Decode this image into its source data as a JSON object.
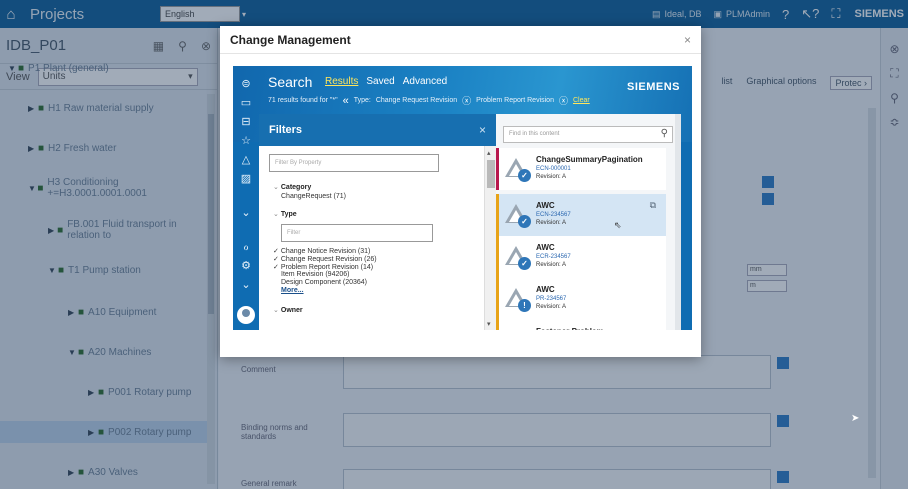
{
  "topbar": {
    "title": "Projects",
    "language": "English",
    "user_items": [
      "Ideal, DB",
      "PLMAdmin"
    ],
    "brand": "SIEMENS",
    "icons": [
      "home-icon",
      "help-icon",
      "context-help-icon",
      "expand-icon"
    ]
  },
  "sidebar": {
    "id": "IDB_P01",
    "view_label": "View",
    "view_value": "Units",
    "tree": [
      {
        "label": "P1 Plant (general)",
        "indent": 0,
        "expanded": true
      },
      {
        "label": "H1 Raw material supply",
        "indent": 1,
        "expanded": false
      },
      {
        "label": "H2 Fresh water",
        "indent": 1,
        "expanded": false
      },
      {
        "label": "H3 Conditioning +=H3.0001.0001.0001",
        "indent": 1,
        "expanded": true
      },
      {
        "label": "FB.001 Fluid transport in relation to",
        "indent": 2,
        "expanded": false
      },
      {
        "label": "T1 Pump station",
        "indent": 2,
        "expanded": true
      },
      {
        "label": "A10 Equipment",
        "indent": 3,
        "expanded": false
      },
      {
        "label": "A20 Machines",
        "indent": 3,
        "expanded": true
      },
      {
        "label": "P001 Rotary pump",
        "indent": 4,
        "expanded": false
      },
      {
        "label": "P002 Rotary pump",
        "indent": 4,
        "expanded": false,
        "selected": true
      },
      {
        "label": "A30 Valves",
        "indent": 3,
        "expanded": false
      }
    ]
  },
  "main": {
    "tabs": [
      "list",
      "Graphical options",
      "Protec"
    ],
    "fields": [
      {
        "label": "Comment"
      },
      {
        "label": "Binding norms and standards"
      },
      {
        "label": "General remark"
      }
    ],
    "mini_fields": [
      "mm",
      "m"
    ]
  },
  "modal": {
    "title": "Change Management",
    "close": "×",
    "aw": {
      "search_title": "Search",
      "tabs": [
        {
          "label": "Results",
          "active": true
        },
        {
          "label": "Saved",
          "active": false
        },
        {
          "label": "Advanced",
          "active": false
        }
      ],
      "brand": "SIEMENS",
      "results_summary": "71 results found for \"*\"",
      "type_label": "Type:",
      "chips": [
        "Change Request Revision",
        "Problem Report Revision"
      ],
      "clear": "Clear",
      "filters": {
        "title": "Filters",
        "filter_by_property_placeholder": "Filter By Property",
        "category": {
          "label": "Category",
          "items": [
            "ChangeRequest  (71)"
          ]
        },
        "type": {
          "label": "Type",
          "filter_placeholder": "Filter",
          "items": [
            {
              "text": "Change Notice Revision  (31)",
              "checked": true
            },
            {
              "text": "Change Request Revision  (26)",
              "checked": true
            },
            {
              "text": "Problem Report Revision  (14)",
              "checked": true
            },
            {
              "text": "Item Revision  (94206)",
              "checked": false
            },
            {
              "text": "Design Component  (20364)",
              "checked": false
            }
          ],
          "more": "More..."
        },
        "owner": {
          "label": "Owner"
        }
      },
      "results": {
        "search_placeholder": "Find in this content",
        "cards": [
          {
            "title": "ChangeSummaryPagination",
            "id": "ECN-000001",
            "rev": "Revision:  A",
            "bar": "#b8174d",
            "badge": "✓",
            "badge_color": "#2e76b8",
            "selected": false
          },
          {
            "title": "AWC",
            "id": "ECN-234567",
            "rev": "Revision:  A",
            "bar": "#e8a317",
            "badge": "✓",
            "badge_color": "#2e76b8",
            "selected": true
          },
          {
            "title": "AWC",
            "id": "ECR-234567",
            "rev": "Revision:  A",
            "bar": "#e8a317",
            "badge": "✓",
            "badge_color": "#2e76b8",
            "selected": false
          },
          {
            "title": "AWC",
            "id": "PR-234567",
            "rev": "Revision:  A",
            "bar": "#e8a317",
            "badge": "!",
            "badge_color": "#2e76b8",
            "selected": false
          },
          {
            "title": "Fastener Problem",
            "id": "",
            "rev": "",
            "bar": "#e8a317",
            "badge": "",
            "badge_color": "#2e76b8",
            "selected": false
          }
        ]
      }
    }
  }
}
